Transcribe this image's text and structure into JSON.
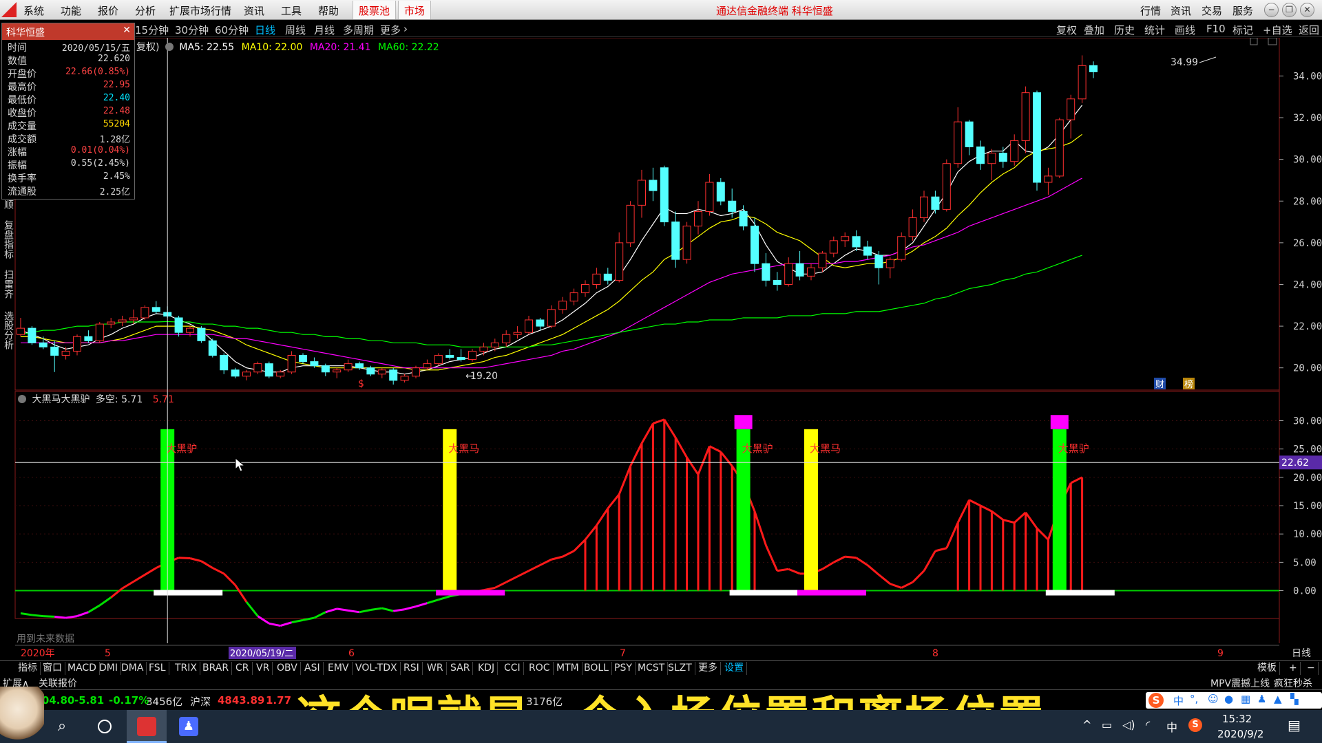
{
  "menubar": {
    "items": [
      "系统",
      "功能",
      "报价",
      "分析",
      "扩展市场行情",
      "资讯",
      "工具",
      "帮助"
    ],
    "highlight_items": [
      "股票池",
      "市场"
    ],
    "app_title": "通达信金融终端 科华恒盛",
    "right_items": [
      "行情",
      "资讯",
      "交易",
      "服务"
    ]
  },
  "periodbar": {
    "periods": [
      "15分钟",
      "30分钟",
      "60分钟",
      "日线",
      "周线",
      "月线",
      "多周期",
      "更多"
    ],
    "active": "日线",
    "tools": [
      "复权",
      "叠加",
      "历史",
      "统计",
      "画线",
      "F10",
      "标记",
      "+自选",
      "返回"
    ]
  },
  "infopanel": {
    "title": "科华恒盛",
    "rows": [
      {
        "label": "时间",
        "value": "2020/05/15/五",
        "color": "#d8d8d8"
      },
      {
        "label": "数值",
        "value": "22.620",
        "color": "#d8d8d8"
      },
      {
        "label": "开盘价",
        "value": "22.66(0.85%)",
        "color": "#ff4444"
      },
      {
        "label": "最高价",
        "value": "22.95",
        "color": "#ff4444"
      },
      {
        "label": "最低价",
        "value": "22.40",
        "color": "#00e5ff"
      },
      {
        "label": "收盘价",
        "value": "22.48",
        "color": "#ff4444"
      },
      {
        "label": "成交量",
        "value": "55204",
        "color": "#ffd700"
      },
      {
        "label": "成交额",
        "value": "1.28亿",
        "color": "#d8d8d8"
      },
      {
        "label": "涨幅",
        "value": "0.01(0.04%)",
        "color": "#ff4444"
      },
      {
        "label": "振幅",
        "value": "0.55(2.45%)",
        "color": "#d8d8d8"
      },
      {
        "label": "换手率",
        "value": "2.45%",
        "color": "#d8d8d8"
      },
      {
        "label": "流通股",
        "value": "2.25亿",
        "color": "#d8d8d8"
      }
    ]
  },
  "lefttabs": [
    "顺",
    "复盘指标",
    "扫雷齐",
    "选股分析"
  ],
  "ma_legend": {
    "prefix": "复权)",
    "items": [
      {
        "text": "MA5: 22.55",
        "color": "#ffffff"
      },
      {
        "text": "MA10: 22.00",
        "color": "#ffff00"
      },
      {
        "text": "MA20: 21.41",
        "color": "#ff00ff"
      },
      {
        "text": "MA60: 22.22",
        "color": "#00ff00"
      }
    ]
  },
  "indicator_legend": {
    "name": "大黑马大黑驴",
    "label": "多空: 5.71",
    "value": "5.71"
  },
  "price_axis": [
    "34.00",
    "32.00",
    "30.00",
    "28.00",
    "26.00",
    "24.00",
    "22.00",
    "20.00"
  ],
  "indicator_axis": [
    "30.00",
    "25.00",
    "20.00",
    "15.00",
    "10.00",
    "5.00",
    "0.00"
  ],
  "cursor_value": "22.62",
  "high_label": "34.99",
  "low_label": "19.20",
  "date_axis": {
    "start": "2020年",
    "ticks": [
      "5",
      "6",
      "7",
      "8",
      "9"
    ],
    "cursor_date": "2020/05/19/二",
    "right_label": "日线"
  },
  "signal_labels": [
    "大黑驴",
    "大黑马",
    "大黑驴",
    "大黑马",
    "大黑驴"
  ],
  "future_note": "用到未来数据",
  "badges": [
    "$",
    "财",
    "榜"
  ],
  "indicator_tabs": [
    "指标",
    "窗口",
    "MACD",
    "DMI",
    "DMA",
    "FSL",
    "TRIX",
    "BRAR",
    "CR",
    "VR",
    "OBV",
    "ASI",
    "EMV",
    "VOL-TDX",
    "RSI",
    "WR",
    "SAR",
    "KDJ",
    "CCI",
    "ROC",
    "MTM",
    "BOLL",
    "PSY",
    "MCST",
    "SLZT",
    "更多",
    "设置"
  ],
  "indicator_right": [
    "模板",
    "+",
    "−"
  ],
  "row2": {
    "left": [
      "扩展∧",
      "关联报价"
    ],
    "right": [
      "MPV震撼上线",
      "疯狂秒杀"
    ]
  },
  "ticker": {
    "sh_value": "3404.80",
    "sh_change": "-5.81",
    "sh_pct": "-0.17%",
    "sh_amount": "3456亿",
    "hs_label": "沪深",
    "hs_value": "4843.89",
    "hs_change": "1.77",
    "amount2": "3176亿"
  },
  "subtitle": "这个呢就是一个入场位置和离场位置",
  "taskbar": {
    "time": "15:32",
    "date": "2020/9/2",
    "ime": "中"
  },
  "chart_data": {
    "type": "candlestick",
    "title": "科华恒盛",
    "ylim": [
      19.0,
      35.5
    ],
    "note": "Daily K-line approx. 2020/04 to 2020/09, with MA5/MA10/MA20/MA60 and custom indicator 大黑马大黑驴",
    "candles": [
      [
        21.6,
        22.4,
        21.5,
        21.9
      ],
      [
        21.9,
        22.0,
        21.1,
        21.2
      ],
      [
        21.2,
        21.5,
        20.9,
        21.0
      ],
      [
        21.0,
        21.3,
        19.8,
        20.6
      ],
      [
        20.6,
        21.0,
        20.4,
        20.8
      ],
      [
        20.8,
        21.6,
        20.6,
        21.5
      ],
      [
        21.5,
        21.8,
        21.2,
        21.3
      ],
      [
        21.3,
        22.2,
        21.2,
        22.1
      ],
      [
        22.1,
        22.4,
        21.9,
        22.2
      ],
      [
        22.2,
        22.5,
        22.0,
        22.3
      ],
      [
        22.3,
        22.8,
        22.1,
        22.4
      ],
      [
        22.4,
        23.0,
        22.3,
        22.9
      ],
      [
        22.9,
        23.2,
        22.6,
        22.7
      ],
      [
        22.66,
        22.95,
        22.4,
        22.48
      ],
      [
        22.4,
        22.5,
        21.5,
        21.7
      ],
      [
        21.7,
        22.0,
        21.5,
        21.9
      ],
      [
        21.9,
        22.0,
        21.2,
        21.3
      ],
      [
        21.3,
        21.4,
        20.5,
        20.6
      ],
      [
        20.6,
        20.7,
        19.7,
        19.9
      ],
      [
        19.9,
        20.0,
        19.5,
        19.6
      ],
      [
        19.6,
        19.9,
        19.4,
        19.8
      ],
      [
        19.8,
        20.3,
        19.7,
        20.2
      ],
      [
        20.2,
        20.3,
        19.5,
        19.6
      ],
      [
        19.6,
        19.9,
        19.5,
        19.8
      ],
      [
        19.8,
        20.8,
        19.7,
        20.6
      ],
      [
        20.6,
        20.7,
        20.2,
        20.3
      ],
      [
        20.3,
        20.5,
        20.0,
        20.1
      ],
      [
        20.1,
        20.2,
        19.6,
        19.8
      ],
      [
        19.8,
        20.0,
        19.5,
        19.9
      ],
      [
        19.9,
        20.4,
        19.8,
        20.2
      ],
      [
        20.2,
        20.3,
        19.9,
        20.0
      ],
      [
        20.0,
        20.1,
        19.6,
        19.7
      ],
      [
        19.7,
        20.0,
        19.5,
        19.9
      ],
      [
        19.9,
        20.0,
        19.2,
        19.4
      ],
      [
        19.4,
        19.7,
        19.3,
        19.6
      ],
      [
        19.6,
        20.1,
        19.5,
        20.0
      ],
      [
        20.0,
        20.4,
        19.9,
        20.2
      ],
      [
        20.2,
        20.7,
        20.1,
        20.6
      ],
      [
        20.6,
        20.9,
        20.4,
        20.5
      ],
      [
        20.5,
        20.9,
        20.3,
        20.4
      ],
      [
        20.4,
        20.9,
        20.3,
        20.8
      ],
      [
        20.8,
        21.2,
        20.6,
        21.0
      ],
      [
        21.0,
        21.4,
        20.8,
        21.2
      ],
      [
        21.2,
        21.8,
        21.0,
        21.6
      ],
      [
        21.6,
        22.0,
        21.4,
        21.7
      ],
      [
        21.7,
        22.5,
        21.6,
        22.3
      ],
      [
        22.3,
        22.4,
        21.8,
        22.0
      ],
      [
        22.0,
        23.0,
        21.9,
        22.8
      ],
      [
        22.8,
        23.4,
        22.6,
        23.2
      ],
      [
        23.2,
        23.8,
        23.0,
        23.6
      ],
      [
        23.6,
        24.2,
        23.4,
        24.0
      ],
      [
        24.0,
        24.8,
        23.8,
        24.5
      ],
      [
        24.5,
        24.8,
        24.0,
        24.2
      ],
      [
        24.2,
        26.5,
        24.1,
        26.0
      ],
      [
        26.0,
        28.0,
        25.8,
        27.8
      ],
      [
        27.8,
        29.5,
        27.2,
        29.0
      ],
      [
        29.0,
        29.6,
        28.0,
        28.5
      ],
      [
        29.6,
        29.7,
        26.8,
        27.0
      ],
      [
        27.0,
        27.5,
        24.8,
        25.2
      ],
      [
        25.2,
        27.0,
        25.0,
        26.8
      ],
      [
        26.8,
        28.0,
        26.4,
        27.5
      ],
      [
        27.5,
        29.3,
        27.3,
        28.9
      ],
      [
        28.9,
        29.1,
        27.8,
        28.0
      ],
      [
        28.0,
        28.6,
        27.2,
        27.5
      ],
      [
        27.5,
        27.8,
        26.6,
        26.8
      ],
      [
        26.8,
        27.2,
        24.6,
        25.0
      ],
      [
        25.0,
        25.5,
        23.9,
        24.2
      ],
      [
        24.2,
        24.6,
        23.7,
        24.0
      ],
      [
        24.0,
        25.3,
        23.9,
        25.0
      ],
      [
        25.0,
        25.6,
        24.2,
        24.4
      ],
      [
        24.4,
        25.0,
        24.2,
        24.8
      ],
      [
        24.8,
        25.6,
        24.6,
        25.5
      ],
      [
        25.5,
        26.3,
        25.3,
        26.1
      ],
      [
        26.1,
        26.5,
        25.8,
        26.3
      ],
      [
        26.3,
        26.6,
        25.6,
        25.8
      ],
      [
        25.8,
        26.1,
        25.2,
        25.4
      ],
      [
        25.4,
        25.6,
        24.0,
        24.8
      ],
      [
        24.8,
        25.3,
        24.3,
        25.2
      ],
      [
        25.2,
        26.5,
        25.1,
        26.3
      ],
      [
        26.3,
        27.6,
        26.1,
        27.2
      ],
      [
        27.2,
        28.5,
        27.0,
        28.2
      ],
      [
        28.2,
        28.5,
        27.4,
        27.6
      ],
      [
        27.6,
        30.0,
        27.5,
        29.8
      ],
      [
        29.8,
        32.5,
        29.6,
        31.8
      ],
      [
        31.8,
        31.9,
        30.2,
        30.6
      ],
      [
        30.6,
        30.9,
        29.5,
        29.8
      ],
      [
        29.8,
        30.5,
        29.0,
        30.3
      ],
      [
        30.3,
        30.6,
        29.6,
        29.9
      ],
      [
        29.9,
        31.2,
        29.7,
        30.9
      ],
      [
        30.9,
        33.5,
        30.3,
        33.2
      ],
      [
        33.2,
        33.3,
        28.5,
        28.9
      ],
      [
        28.9,
        29.6,
        28.3,
        29.2
      ],
      [
        29.2,
        32.0,
        29.1,
        31.9
      ],
      [
        31.9,
        33.1,
        31.0,
        32.9
      ],
      [
        32.9,
        34.99,
        32.7,
        34.5
      ],
      [
        34.5,
        34.7,
        33.9,
        34.2
      ]
    ],
    "ma": {
      "MA5": [
        21.8,
        21.6,
        21.4,
        21.1,
        20.9,
        21.0,
        21.1,
        21.4,
        21.6,
        21.9,
        22.1,
        22.4,
        22.6,
        22.55,
        22.3,
        22.1,
        21.8,
        21.3,
        20.8,
        20.3,
        20.0,
        19.9,
        19.8,
        19.8,
        20.0,
        20.1,
        20.1,
        20.1,
        20.1,
        20.1,
        20.0,
        19.9,
        19.8,
        19.8,
        19.7,
        19.8,
        19.9,
        20.1,
        20.3,
        20.4,
        20.5,
        20.7,
        20.9,
        21.0,
        21.3,
        21.6,
        21.8,
        22.0,
        22.3,
        22.7,
        23.1,
        23.6,
        23.9,
        24.4,
        25.2,
        26.1,
        26.9,
        27.7,
        27.4,
        27.4,
        27.6,
        27.5,
        27.3,
        27.4,
        27.6,
        26.9,
        25.9,
        25.1,
        24.8,
        24.5,
        24.5,
        24.6,
        25.0,
        25.4,
        25.7,
        25.6,
        25.4,
        25.4,
        25.6,
        26.0,
        26.8,
        27.6,
        28.4,
        29.4,
        29.9,
        30.2,
        30.4,
        30.4,
        30.9,
        30.4,
        30.3,
        30.6,
        31.2,
        31.9,
        32.6
      ],
      "MA10": [
        21.5,
        21.5,
        21.4,
        21.3,
        21.2,
        21.2,
        21.2,
        21.2,
        21.3,
        21.4,
        21.6,
        21.8,
        22.0,
        22.0,
        22.0,
        22.0,
        21.9,
        21.8,
        21.6,
        21.4,
        21.1,
        20.9,
        20.7,
        20.5,
        20.3,
        20.2,
        20.1,
        20.0,
        20.0,
        20.0,
        20.0,
        20.0,
        20.0,
        20.0,
        20.0,
        19.9,
        19.9,
        19.9,
        20.0,
        20.1,
        20.2,
        20.3,
        20.5,
        20.6,
        20.8,
        21.0,
        21.2,
        21.4,
        21.6,
        21.9,
        22.2,
        22.5,
        22.8,
        23.2,
        23.7,
        24.2,
        24.6,
        25.2,
        25.5,
        25.9,
        26.3,
        26.7,
        27.0,
        27.1,
        27.3,
        27.2,
        26.9,
        26.5,
        26.3,
        26.1,
        25.7,
        25.3,
        24.9,
        24.8,
        24.9,
        25.0,
        25.0,
        25.1,
        25.3,
        25.6,
        26.0,
        26.3,
        26.7,
        27.3,
        27.8,
        28.4,
        28.9,
        29.3,
        29.6,
        30.1,
        30.4,
        30.5,
        30.6,
        30.8,
        31.2
      ],
      "MA20": [
        21.2,
        21.2,
        21.2,
        21.2,
        21.2,
        21.2,
        21.2,
        21.2,
        21.3,
        21.3,
        21.4,
        21.5,
        21.6,
        21.6,
        21.6,
        21.6,
        21.6,
        21.6,
        21.5,
        21.4,
        21.4,
        21.3,
        21.2,
        21.1,
        21.0,
        20.9,
        20.8,
        20.7,
        20.6,
        20.5,
        20.4,
        20.3,
        20.2,
        20.1,
        20.0,
        20.0,
        20.0,
        20.0,
        20.0,
        20.0,
        20.0,
        20.0,
        20.1,
        20.2,
        20.3,
        20.4,
        20.5,
        20.6,
        20.8,
        20.9,
        21.1,
        21.3,
        21.5,
        21.7,
        22.0,
        22.3,
        22.6,
        22.9,
        23.2,
        23.5,
        23.8,
        24.1,
        24.3,
        24.5,
        24.6,
        24.7,
        24.8,
        24.9,
        25.0,
        25.0,
        25.0,
        25.0,
        25.0,
        25.1,
        25.1,
        25.2,
        25.3,
        25.4,
        25.6,
        25.8,
        25.9,
        26.1,
        26.3,
        26.5,
        26.8,
        27.0,
        27.2,
        27.4,
        27.6,
        27.8,
        28.0,
        28.2,
        28.5,
        28.8,
        29.1
      ],
      "MA60": [
        21.6,
        21.7,
        21.8,
        21.8,
        21.9,
        22.0,
        22.0,
        22.1,
        22.1,
        22.2,
        22.2,
        22.2,
        22.2,
        22.22,
        22.2,
        22.2,
        22.1,
        22.1,
        22.0,
        22.0,
        21.9,
        21.9,
        21.8,
        21.7,
        21.7,
        21.6,
        21.6,
        21.5,
        21.5,
        21.4,
        21.4,
        21.3,
        21.3,
        21.2,
        21.2,
        21.2,
        21.1,
        21.1,
        21.1,
        21.0,
        21.0,
        21.0,
        21.0,
        21.0,
        21.0,
        21.0,
        21.1,
        21.1,
        21.2,
        21.3,
        21.4,
        21.5,
        21.6,
        21.7,
        21.8,
        21.9,
        22.0,
        22.1,
        22.1,
        22.2,
        22.2,
        22.3,
        22.3,
        22.3,
        22.4,
        22.4,
        22.4,
        22.4,
        22.5,
        22.5,
        22.5,
        22.6,
        22.6,
        22.6,
        22.7,
        22.7,
        22.7,
        22.8,
        22.9,
        23.0,
        23.1,
        23.3,
        23.4,
        23.6,
        23.8,
        23.9,
        24.0,
        24.2,
        24.3,
        24.5,
        24.6,
        24.8,
        25.0,
        25.2,
        25.4
      ]
    },
    "indicator": {
      "name": "大黑马大黑驴",
      "ylim": [
        -2,
        32
      ],
      "line": [
        -4,
        -4.3,
        -4.5,
        -4.6,
        -4.8,
        -4.5,
        -3.8,
        -2.6,
        -1.2,
        0.4,
        1.6,
        2.8,
        4.0,
        5.0,
        5.8,
        5.71,
        5.2,
        4.0,
        3.0,
        1.0,
        -2.0,
        -4.5,
        -5.8,
        -6.2,
        -5.6,
        -5.2,
        -4.8,
        -3.8,
        -3.2,
        -3.5,
        -3.8,
        -3.4,
        -3.1,
        -3.6,
        -3.3,
        -2.8,
        -2.2,
        -1.6,
        -1.0,
        -0.6,
        -0.3,
        0.1,
        0.5,
        1.5,
        2.5,
        3.5,
        4.5,
        5.5,
        6.0,
        7.0,
        9.0,
        11.5,
        14.5,
        17.0,
        22.0,
        26.0,
        29.5,
        30.2,
        27.0,
        23.5,
        20.5,
        25.5,
        24.5,
        22.0,
        19.0,
        14.0,
        8.0,
        3.5,
        3.8,
        3.0,
        3.0,
        3.8,
        5.0,
        6.0,
        5.8,
        4.5,
        2.8,
        1.2,
        0.5,
        1.5,
        3.5,
        7.0,
        7.5,
        12.0,
        16.0,
        15.0,
        14.0,
        12.5,
        12.0,
        13.8,
        11.0,
        9.0,
        14.8,
        19.0,
        20.0
      ],
      "buy_bars": [
        {
          "index": 13,
          "type": "大黑驴",
          "color": "#00ff00"
        },
        {
          "index": 64,
          "type": "大黑驴",
          "color": "#00ff00"
        },
        {
          "index": 92,
          "type": "大黑驴",
          "color": "#00ff00"
        }
      ],
      "mark_bars": [
        {
          "index": 38,
          "type": "大黑马",
          "color": "#ffff00"
        },
        {
          "index": 70,
          "type": "大黑马",
          "color": "#ffff00"
        }
      ]
    }
  }
}
